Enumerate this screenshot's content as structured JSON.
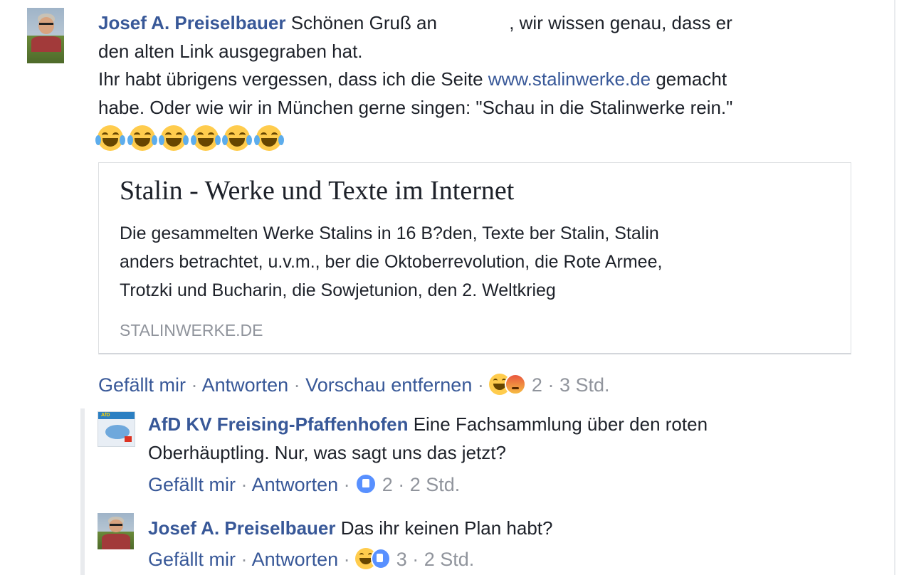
{
  "comment1": {
    "author": "Josef A. Preiselbauer",
    "line1_text": "Schönen Gruß an",
    "line1_rest": ", wir wissen genau, dass er",
    "line2": "den alten Link ausgegraben hat.",
    "line3_pre": "Ihr habt übrigens vergessen, dass ich die Seite",
    "line3_link": "www.stalinwerke.de",
    "line3_post": "gemacht",
    "line4": "habe. Oder wie wir in München gerne singen: \"Schau in die Stalinwerke rein.\"",
    "emoji_count": 6,
    "emoji_icon": "face-with-tears-of-joy-icon",
    "preview": {
      "title": "Stalin - Werke und Texte im Internet",
      "desc_lines": [
        "Die gesammelten Werke Stalins in 16 B?den, Texte ber Stalin, Stalin",
        "anders betrachtet, u.v.m., ber die Oktoberrevolution, die Rote Armee,",
        "Trotzki und Bucharin, die Sowjetunion, den 2. Weltkrieg"
      ],
      "domain": "STALINWERKE.DE"
    },
    "actions": {
      "like": "Gefällt mir",
      "reply": "Antworten",
      "remove_preview": "Vorschau entfernen",
      "reaction_count": "2",
      "time": "3 Std."
    }
  },
  "reply1": {
    "author": "AfD KV Freising-Pfaffenhofen",
    "text_line1": "Eine Fachsammlung über den roten",
    "text_line2": "Oberhäuptling. Nur, was sagt uns das jetzt?",
    "avatar_text": "AfD",
    "actions": {
      "like": "Gefällt mir",
      "reply": "Antworten",
      "reaction_count": "2",
      "time": "2 Std."
    }
  },
  "reply2": {
    "author": "Josef A. Preiselbauer",
    "text": "Das ihr keinen Plan habt?",
    "actions": {
      "like": "Gefällt mir",
      "reply": "Antworten",
      "reaction_count": "3",
      "time": "2 Std."
    }
  },
  "separator": "·",
  "colors": {
    "link": "#385898",
    "meta": "#90949c",
    "text": "#1d2129"
  }
}
